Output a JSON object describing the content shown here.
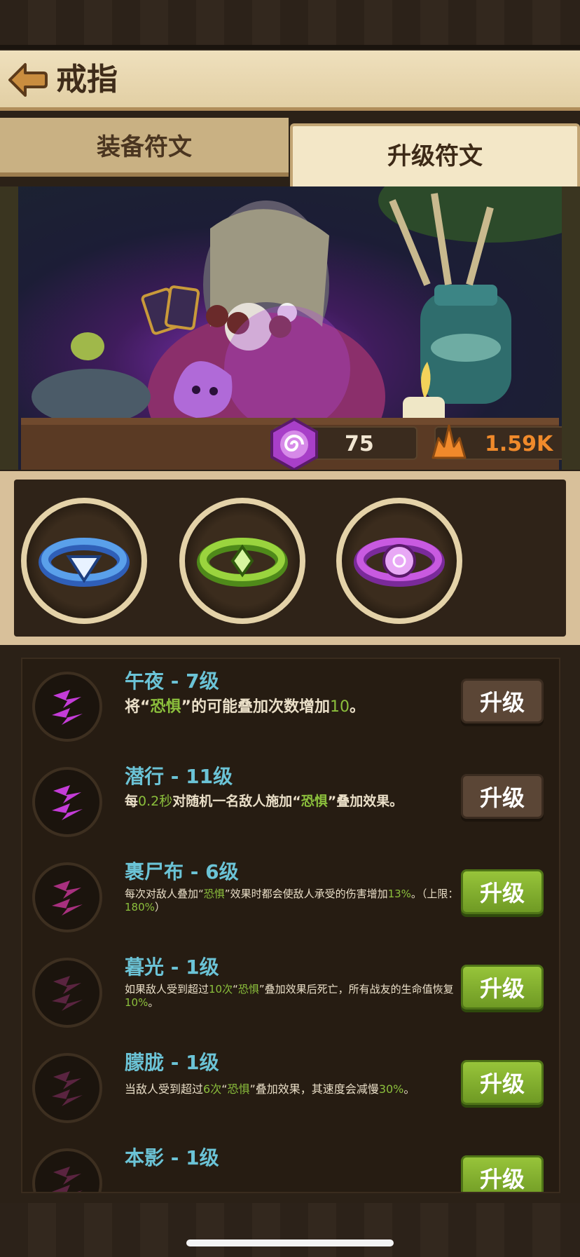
{
  "header": {
    "title": "戒指"
  },
  "tabs": {
    "equip": "装备符文",
    "upgrade": "升级符文",
    "active": "升级符文"
  },
  "resources": {
    "runes": "75",
    "crystals": "1.59K"
  },
  "rings": [
    {
      "name": "blue-ring",
      "color": "#3f7fd6"
    },
    {
      "name": "green-ring",
      "color": "#7cbf2a"
    },
    {
      "name": "purple-ring",
      "color": "#a83fc8"
    }
  ],
  "runes": [
    {
      "name": "午夜 - 7级",
      "desc": [
        {
          "t": "将“"
        },
        {
          "t": "恐惧",
          "k": "hl"
        },
        {
          "t": "”的可能叠加次数增加"
        },
        {
          "t": "10",
          "k": "num"
        },
        {
          "t": "。"
        }
      ],
      "button": "升级",
      "button_state": "gray",
      "icon": "midnight-rune-icon",
      "icon_color": "#c43cd8",
      "size": "big"
    },
    {
      "name": "潜行 - 11级",
      "desc": [
        {
          "t": "每"
        },
        {
          "t": "0.2秒",
          "k": "num"
        },
        {
          "t": "对随机一名敌人施加“"
        },
        {
          "t": "恐惧",
          "k": "hl"
        },
        {
          "t": "”叠加效果。"
        }
      ],
      "button": "升级",
      "button_state": "gray",
      "icon": "stealth-rune-icon",
      "icon_color": "#c43cd8",
      "size": "big-sm"
    },
    {
      "name": "裹尸布 - 6级",
      "desc": [
        {
          "t": "每次对敌人叠加“"
        },
        {
          "t": "恐惧",
          "k": "hl"
        },
        {
          "t": "”效果时都会使敌人承受的伤害增加"
        },
        {
          "t": "13%",
          "k": "num"
        },
        {
          "t": "。（上限："
        },
        {
          "t": "180%",
          "k": "num"
        },
        {
          "t": "）"
        }
      ],
      "button": "升级",
      "button_state": "green",
      "icon": "shroud-rune-icon",
      "icon_color": "#a8307f",
      "size": "small"
    },
    {
      "name": "暮光 - 1级",
      "desc": [
        {
          "t": "如果敌人受到超过"
        },
        {
          "t": "10次",
          "k": "num"
        },
        {
          "t": "“"
        },
        {
          "t": "恐惧",
          "k": "hl"
        },
        {
          "t": "”叠加效果后死亡，所有战友的生命值恢复"
        },
        {
          "t": "10%",
          "k": "num"
        },
        {
          "t": "。"
        }
      ],
      "button": "升级",
      "button_state": "green",
      "icon": "twilight-rune-icon",
      "icon_color": "#5a2440",
      "size": "small"
    },
    {
      "name": "朦胧 - 1级",
      "desc": [
        {
          "t": "当敌人受到超过"
        },
        {
          "t": "6次",
          "k": "num"
        },
        {
          "t": "“"
        },
        {
          "t": "恐惧",
          "k": "hl"
        },
        {
          "t": "”叠加效果，其速度会减慢"
        },
        {
          "t": "30%",
          "k": "num"
        },
        {
          "t": "。"
        }
      ],
      "button": "升级",
      "button_state": "green",
      "icon": "haze-rune-icon",
      "icon_color": "#5a2440",
      "size": "small-one"
    },
    {
      "name": "本影 - 1级",
      "desc": [],
      "button": "升级",
      "button_state": "green",
      "icon": "umbra-rune-icon",
      "icon_color": "#5a2440",
      "size": "small"
    }
  ]
}
